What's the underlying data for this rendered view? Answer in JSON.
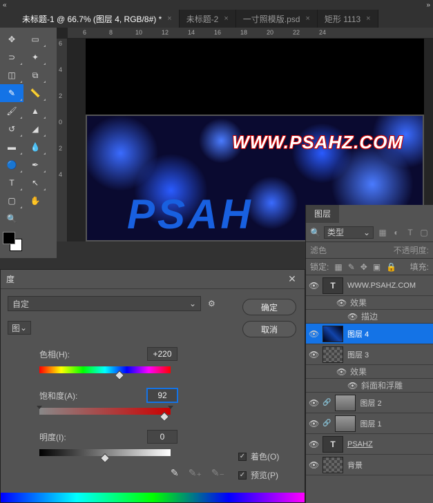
{
  "chevrons": {
    "left": "«",
    "right": "»"
  },
  "tabs": [
    {
      "label": "未标题-1 @ 66.7% (图层 4, RGB/8#) *",
      "active": true
    },
    {
      "label": "未标题-2",
      "active": false
    },
    {
      "label": "一寸照模版.psd",
      "active": false
    },
    {
      "label": "矩形 1113",
      "active": false
    }
  ],
  "ruler_h": [
    "6",
    "8",
    "10",
    "12",
    "14",
    "16",
    "18",
    "20",
    "22",
    "24"
  ],
  "ruler_v": [
    "6",
    "4",
    "2",
    "0",
    "2",
    "4"
  ],
  "canvas": {
    "url": "WWW.PSAHZ.COM",
    "big": "PSAH"
  },
  "dialog": {
    "title": "度",
    "preset_label": "自定",
    "ok": "确定",
    "cancel": "取消",
    "small_select": "图",
    "hue": {
      "label": "色相(H):",
      "value": "+220",
      "pos": 61
    },
    "sat": {
      "label": "饱和度(A):",
      "value": "92",
      "pos": 95
    },
    "lig": {
      "label": "明度(I):",
      "value": "0",
      "pos": 50
    },
    "colorize": "着色(O)",
    "preview": "预览(P)"
  },
  "layers_panel": {
    "tab": "图层",
    "type_label": "类型",
    "blend": "滤色",
    "opacity_label": "不透明度:",
    "lock_label": "锁定:",
    "fill_label": "填充:",
    "items": [
      {
        "kind": "text",
        "name": "WWW.PSAHZ.COM",
        "eye": true
      },
      {
        "kind": "fx-hdr",
        "name": "效果"
      },
      {
        "kind": "fx-sub",
        "name": "描边"
      },
      {
        "kind": "layer",
        "name": "图层 4",
        "sel": true,
        "thumb": "lightning"
      },
      {
        "kind": "layer",
        "name": "图层 3",
        "thumb": "checker"
      },
      {
        "kind": "fx-hdr",
        "name": "效果"
      },
      {
        "kind": "fx-sub",
        "name": "斜面和浮雕"
      },
      {
        "kind": "layer",
        "name": "图层 2",
        "thumb": "cloud",
        "link": true
      },
      {
        "kind": "layer",
        "name": "图层 1",
        "thumb": "cloud",
        "link": true
      },
      {
        "kind": "text",
        "name": "PSAHZ",
        "underline": true
      },
      {
        "kind": "layer",
        "name": "背景",
        "thumb": "checker"
      }
    ]
  }
}
